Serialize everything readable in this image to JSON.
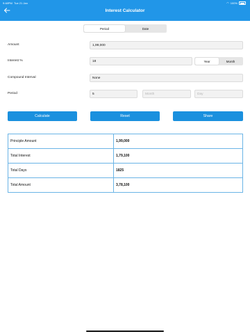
{
  "status": {
    "time": "9:48PM",
    "date": "Tue 21 Jan",
    "battery": "100%"
  },
  "header": {
    "title": "Interest Calculator"
  },
  "mode_tabs": [
    {
      "label": "Period",
      "active": true
    },
    {
      "label": "Date",
      "active": false
    }
  ],
  "form": {
    "amount_label": "Amount",
    "amount_value": "1,99,000",
    "interest_label": "Interest %",
    "interest_value": "18",
    "rate_units": [
      {
        "label": "Year",
        "active": true
      },
      {
        "label": "Month",
        "active": false
      }
    ],
    "compound_label": "Compound Interval",
    "compound_value": "None",
    "period_label": "Period",
    "period_value": "5",
    "month_placeholder": "Month",
    "day_placeholder": "Day"
  },
  "actions": {
    "calculate": "Calculate",
    "reset": "Reset",
    "share": "Share"
  },
  "results": [
    {
      "label": "Principle Amount",
      "value": "1,99,000"
    },
    {
      "label": "Total Interest",
      "value": "1,79,100"
    },
    {
      "label": "Total Days",
      "value": "1825"
    },
    {
      "label": "Total Amount",
      "value": "3,78,100"
    }
  ],
  "colors": {
    "accent": "#2196e8",
    "button": "#1a90de",
    "table_border": "#6ab4e6"
  }
}
